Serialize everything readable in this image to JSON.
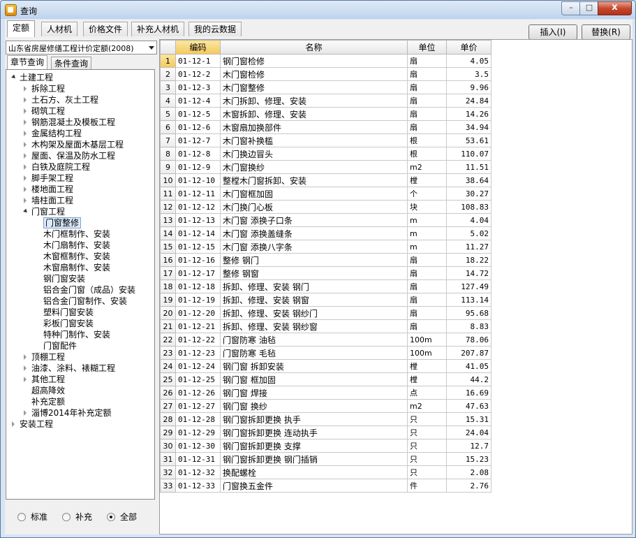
{
  "window": {
    "title": "查询",
    "min": "–",
    "max": "□",
    "close": "x"
  },
  "tabs": [
    "定额",
    "人材机",
    "价格文件",
    "补充人材机",
    "我的云数据"
  ],
  "actions": {
    "insert": "插入(I)",
    "replace": "替换(R)"
  },
  "left": {
    "combo": "山东省房屋修缮工程计价定额(2008)",
    "subtabs": [
      "章节查询",
      "条件查询"
    ],
    "tree": [
      {
        "label": "土建工程",
        "level": 0,
        "exp": "open"
      },
      {
        "label": "拆除工程",
        "level": 1,
        "exp": "closed"
      },
      {
        "label": "土石方、灰土工程",
        "level": 1,
        "exp": "closed"
      },
      {
        "label": "砌筑工程",
        "level": 1,
        "exp": "closed"
      },
      {
        "label": "钢筋混凝土及模板工程",
        "level": 1,
        "exp": "closed"
      },
      {
        "label": "金属结构工程",
        "level": 1,
        "exp": "closed"
      },
      {
        "label": "木构架及屋面木基层工程",
        "level": 1,
        "exp": "closed"
      },
      {
        "label": "屋面、保温及防水工程",
        "level": 1,
        "exp": "closed"
      },
      {
        "label": "白铁及庭院工程",
        "level": 1,
        "exp": "closed"
      },
      {
        "label": "脚手架工程",
        "level": 1,
        "exp": "closed"
      },
      {
        "label": "楼地面工程",
        "level": 1,
        "exp": "closed"
      },
      {
        "label": "墙柱面工程",
        "level": 1,
        "exp": "closed"
      },
      {
        "label": "门窗工程",
        "level": 1,
        "exp": "open"
      },
      {
        "label": "门窗整修",
        "level": 2,
        "exp": "none",
        "selected": true
      },
      {
        "label": "木门框制作、安装",
        "level": 2,
        "exp": "none"
      },
      {
        "label": "木门扇制作、安装",
        "level": 2,
        "exp": "none"
      },
      {
        "label": "木窗框制作、安装",
        "level": 2,
        "exp": "none"
      },
      {
        "label": "木窗扇制作、安装",
        "level": 2,
        "exp": "none"
      },
      {
        "label": "钢门窗安装",
        "level": 2,
        "exp": "none"
      },
      {
        "label": "铝合金门窗（成品）安装",
        "level": 2,
        "exp": "none"
      },
      {
        "label": "铝合金门窗制作、安装",
        "level": 2,
        "exp": "none"
      },
      {
        "label": "塑料门窗安装",
        "level": 2,
        "exp": "none"
      },
      {
        "label": "彩板门窗安装",
        "level": 2,
        "exp": "none"
      },
      {
        "label": "特种门制作、安装",
        "level": 2,
        "exp": "none"
      },
      {
        "label": "门窗配件",
        "level": 2,
        "exp": "none"
      },
      {
        "label": "顶棚工程",
        "level": 1,
        "exp": "closed"
      },
      {
        "label": "油漆、涂料、裱糊工程",
        "level": 1,
        "exp": "closed"
      },
      {
        "label": "其他工程",
        "level": 1,
        "exp": "closed"
      },
      {
        "label": "超高降效",
        "level": 1,
        "exp": "none"
      },
      {
        "label": "补充定额",
        "level": 1,
        "exp": "none"
      },
      {
        "label": "淄博2014年补充定额",
        "level": 1,
        "exp": "closed"
      },
      {
        "label": "安装工程",
        "level": 0,
        "exp": "closed"
      }
    ],
    "radios": [
      {
        "label": "标准",
        "checked": false
      },
      {
        "label": "补充",
        "checked": false
      },
      {
        "label": "全部",
        "checked": true
      }
    ]
  },
  "grid": {
    "headers": {
      "idx": "",
      "code": "编码",
      "name": "名称",
      "unit": "单位",
      "price": "单价"
    },
    "rows": [
      {
        "idx": "1",
        "code": "01-12-1",
        "name": "钢门窗检修",
        "unit": "扇",
        "price": "4.05"
      },
      {
        "idx": "2",
        "code": "01-12-2",
        "name": "木门窗检修",
        "unit": "扇",
        "price": "3.5"
      },
      {
        "idx": "3",
        "code": "01-12-3",
        "name": "木门窗整修",
        "unit": "扇",
        "price": "9.96"
      },
      {
        "idx": "4",
        "code": "01-12-4",
        "name": "木门拆卸、修理、安装",
        "unit": "扇",
        "price": "24.84"
      },
      {
        "idx": "5",
        "code": "01-12-5",
        "name": "木窗拆卸、修理、安装",
        "unit": "扇",
        "price": "14.26"
      },
      {
        "idx": "6",
        "code": "01-12-6",
        "name": "木窗扇加换部件",
        "unit": "扇",
        "price": "34.94"
      },
      {
        "idx": "7",
        "code": "01-12-7",
        "name": "木门窗补换槛",
        "unit": "根",
        "price": "53.61"
      },
      {
        "idx": "8",
        "code": "01-12-8",
        "name": "木门换边冒头",
        "unit": "根",
        "price": "110.07"
      },
      {
        "idx": "9",
        "code": "01-12-9",
        "name": "木门窗换纱",
        "unit": "m2",
        "price": "11.51"
      },
      {
        "idx": "10",
        "code": "01-12-10",
        "name": "整樘木门窗拆卸、安装",
        "unit": "樘",
        "price": "38.64"
      },
      {
        "idx": "11",
        "code": "01-12-11",
        "name": "木门窗框加固",
        "unit": "个",
        "price": "30.27"
      },
      {
        "idx": "12",
        "code": "01-12-12",
        "name": "木门换门心板",
        "unit": "块",
        "price": "108.83"
      },
      {
        "idx": "13",
        "code": "01-12-13",
        "name": "木门窗 添换子口条",
        "unit": "m",
        "price": "4.04"
      },
      {
        "idx": "14",
        "code": "01-12-14",
        "name": "木门窗 添换盖缝条",
        "unit": "m",
        "price": "5.02"
      },
      {
        "idx": "15",
        "code": "01-12-15",
        "name": "木门窗 添换八字条",
        "unit": "m",
        "price": "11.27"
      },
      {
        "idx": "16",
        "code": "01-12-16",
        "name": "整修 钢门",
        "unit": "扇",
        "price": "18.22"
      },
      {
        "idx": "17",
        "code": "01-12-17",
        "name": "整修 钢窗",
        "unit": "扇",
        "price": "14.72"
      },
      {
        "idx": "18",
        "code": "01-12-18",
        "name": "拆卸、修理、安装 钢门",
        "unit": "扇",
        "price": "127.49"
      },
      {
        "idx": "19",
        "code": "01-12-19",
        "name": "拆卸、修理、安装 钢窗",
        "unit": "扇",
        "price": "113.14"
      },
      {
        "idx": "20",
        "code": "01-12-20",
        "name": "拆卸、修理、安装 钢纱门",
        "unit": "扇",
        "price": "95.68"
      },
      {
        "idx": "21",
        "code": "01-12-21",
        "name": "拆卸、修理、安装 钢纱窗",
        "unit": "扇",
        "price": "8.83"
      },
      {
        "idx": "22",
        "code": "01-12-22",
        "name": "门窗防寒 油毡",
        "unit": "100m",
        "price": "78.06"
      },
      {
        "idx": "23",
        "code": "01-12-23",
        "name": "门窗防寒 毛毡",
        "unit": "100m",
        "price": "207.87"
      },
      {
        "idx": "24",
        "code": "01-12-24",
        "name": "钢门窗 拆卸安装",
        "unit": "樘",
        "price": "41.05"
      },
      {
        "idx": "25",
        "code": "01-12-25",
        "name": "钢门窗 框加固",
        "unit": "樘",
        "price": "44.2"
      },
      {
        "idx": "26",
        "code": "01-12-26",
        "name": "钢门窗 焊接",
        "unit": "点",
        "price": "16.69"
      },
      {
        "idx": "27",
        "code": "01-12-27",
        "name": "钢门窗 换纱",
        "unit": "m2",
        "price": "47.63"
      },
      {
        "idx": "28",
        "code": "01-12-28",
        "name": "钢门窗拆卸更换 执手",
        "unit": "只",
        "price": "15.31"
      },
      {
        "idx": "29",
        "code": "01-12-29",
        "name": "钢门窗拆卸更换 连动执手",
        "unit": "只",
        "price": "24.04"
      },
      {
        "idx": "30",
        "code": "01-12-30",
        "name": "钢门窗拆卸更换 支撑",
        "unit": "只",
        "price": "12.7"
      },
      {
        "idx": "31",
        "code": "01-12-31",
        "name": "钢门窗拆卸更换 钢门插销",
        "unit": "只",
        "price": "15.23"
      },
      {
        "idx": "32",
        "code": "01-12-32",
        "name": "换配螺栓",
        "unit": "只",
        "price": "2.08"
      },
      {
        "idx": "33",
        "code": "01-12-33",
        "name": "门窗换五金件",
        "unit": "件",
        "price": "2.76"
      }
    ]
  }
}
